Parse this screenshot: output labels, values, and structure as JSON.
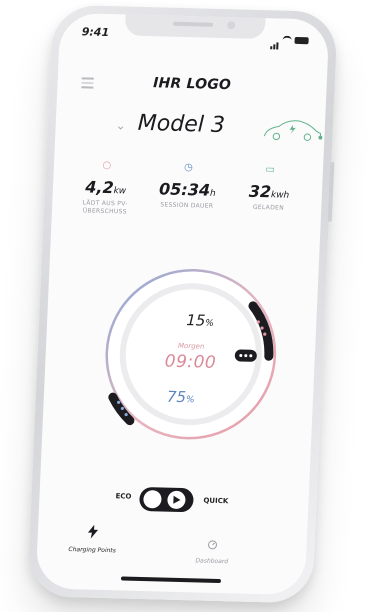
{
  "status_bar": {
    "time": "9:41"
  },
  "header": {
    "logo": "IHR LOGO"
  },
  "vehicle": {
    "model_name": "Model 3"
  },
  "stats": [
    {
      "icon": "sun-icon",
      "color": "#e79aa6",
      "value": "4,2",
      "unit": "kw",
      "label": "LÄDT AUS PV-ÜBERSCHUSS"
    },
    {
      "icon": "clock-icon",
      "color": "#5e86bf",
      "value": "05:34",
      "unit": "h",
      "label": "SESSION DAUER"
    },
    {
      "icon": "battery-icon",
      "color": "#62b38b",
      "value": "32",
      "unit": "kwh",
      "label": "GELADEN"
    }
  ],
  "charging_dial": {
    "min_percent": "15",
    "max_percent": "75",
    "percent_unit": "%",
    "departure_label": "Morgen",
    "departure_time": "09:00",
    "colors": {
      "accent_blue": "#5e86bf",
      "accent_pink": "#e79aa6"
    }
  },
  "mode_toggle": {
    "left_label": "ECO",
    "right_label": "QUICK",
    "selected": "QUICK"
  },
  "tabbar": {
    "items": [
      {
        "label": "Charging Points",
        "icon": "lightning-icon",
        "active": true
      },
      {
        "label": "Dashboard",
        "icon": "gauge-icon",
        "active": false
      }
    ]
  }
}
